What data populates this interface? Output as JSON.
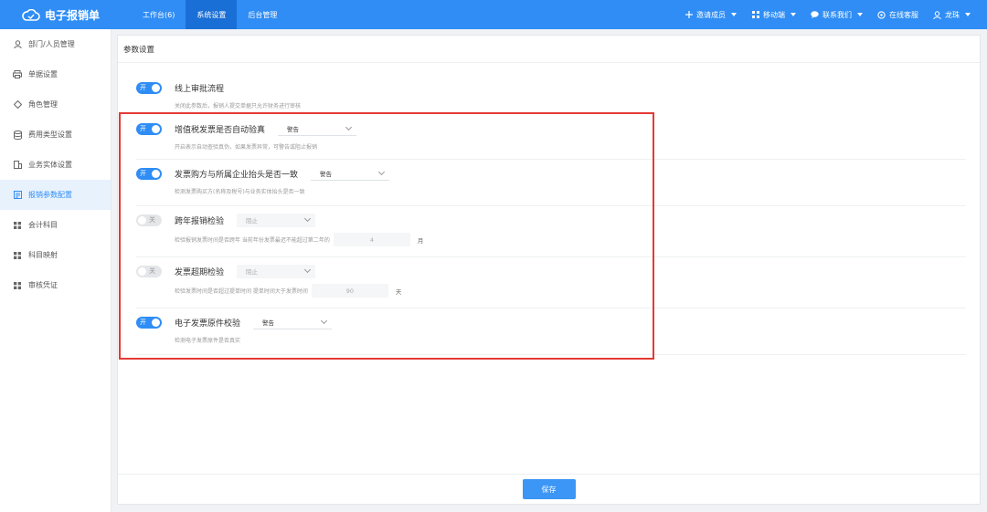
{
  "app": {
    "title": "电子报销单"
  },
  "topnav": {
    "tabs": [
      {
        "label": "工作台(6)"
      },
      {
        "label": "系统设置"
      },
      {
        "label": "后台管理"
      }
    ]
  },
  "topright": {
    "invite": "邀请成员",
    "mobile": "移动端",
    "contact": "联系我们",
    "online": "在线客服",
    "user": "龙珠"
  },
  "sidebar": {
    "items": [
      {
        "label": "部门/人员管理",
        "icon": "user-icon"
      },
      {
        "label": "单据设置",
        "icon": "printer-icon"
      },
      {
        "label": "角色管理",
        "icon": "role-icon"
      },
      {
        "label": "费用类型设置",
        "icon": "database-icon"
      },
      {
        "label": "业务实体设置",
        "icon": "building-icon"
      },
      {
        "label": "报销参数配置",
        "icon": "document-icon"
      },
      {
        "label": "会计科目",
        "icon": "grid-icon"
      },
      {
        "label": "科目映射",
        "icon": "grid-icon"
      },
      {
        "label": "审核凭证",
        "icon": "grid-icon"
      }
    ]
  },
  "panel": {
    "title": "参数设置"
  },
  "settings": [
    {
      "toggle": "开",
      "label": "线上审批流程",
      "desc": "关闭此参数后，报销人提交单据只允许财务进行审核"
    },
    {
      "toggle": "开",
      "label": "增值税发票是否自动验真",
      "select": "警告",
      "desc": "开启表示自动查验真伪，如果发票异常，可警告或阻止报销"
    },
    {
      "toggle": "开",
      "label": "发票购方与所属企业抬头是否一致",
      "select": "警告",
      "desc": "检测发票购买方(名称及税号)与业务实体抬头是否一致"
    },
    {
      "toggle": "关",
      "label": "跨年报销检验",
      "select": "阻止",
      "desc": "检验报销发票时间是否跨年 当前年份发票最迟不能超过第二年的",
      "value": "4",
      "unit": "月"
    },
    {
      "toggle": "关",
      "label": "发票超期检验",
      "select": "阻止",
      "desc": "检验发票时间是否超过提单时间 提单时间大于发票时间",
      "value": "90",
      "unit": "天"
    },
    {
      "toggle": "开",
      "label": "电子发票原件校验",
      "select": "警告",
      "desc": "检测电子发票原件是否真实"
    }
  ],
  "footer": {
    "save": "保存"
  },
  "colors": {
    "primary": "#2f8df5",
    "highlight": "#e53935"
  }
}
